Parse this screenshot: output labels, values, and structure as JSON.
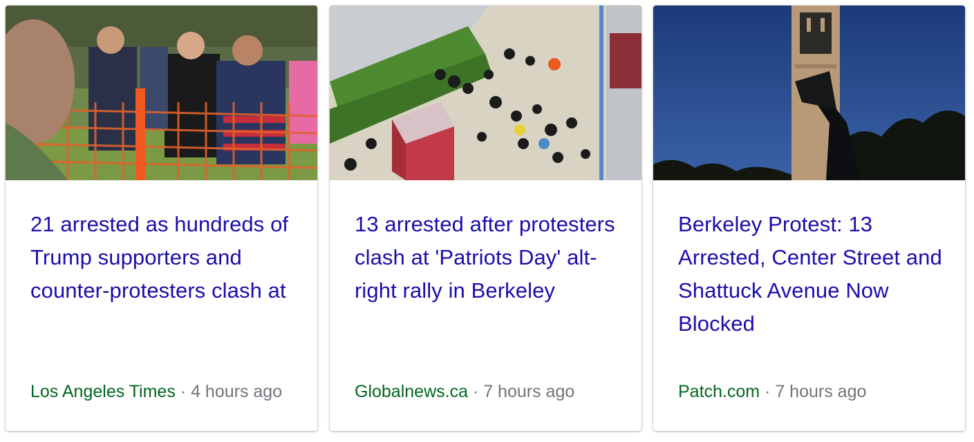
{
  "cards": [
    {
      "headline": "21 arrested as hundreds of Trump supporters and counter-protesters clash at",
      "source": "Los Angeles Times",
      "separator": " · ",
      "time": "4 hours ago",
      "thumbnail": "protest-crowd-fence-photo"
    },
    {
      "headline": "13 arrested after protesters clash at 'Patriots Day' alt-right rally in Berkeley",
      "source": "Globalnews.ca",
      "separator": " · ",
      "time": "7 hours ago",
      "thumbnail": "aerial-plaza-crowd-photo"
    },
    {
      "headline": "Berkeley Protest: 13 Arrested, Center Street and Shattuck Avenue Now Blocked",
      "source": "Patch.com",
      "separator": " · ",
      "time": "7 hours ago",
      "thumbnail": "campanile-megaphone-photo"
    }
  ],
  "colors": {
    "headline": "#1a0dab",
    "source": "#006621",
    "meta": "#70757a"
  }
}
